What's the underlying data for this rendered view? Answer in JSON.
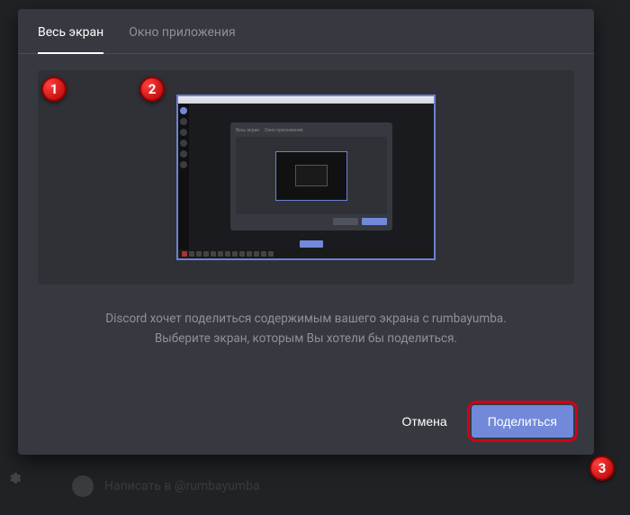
{
  "tabs": {
    "entire_screen": "Весь экран",
    "app_window": "Окно приложения"
  },
  "description": {
    "line1": "Discord хочет поделиться содержимым вашего экрана с rumbayumba.",
    "line2": "Выберите экран, которым Вы хотели бы поделиться."
  },
  "footer": {
    "cancel": "Отмена",
    "share": "Поделиться"
  },
  "callouts": {
    "one": "1",
    "two": "2",
    "three": "3"
  },
  "background": {
    "status_text": "Написать в @rumbayumba"
  },
  "inner_modal_tabs": {
    "a": "Весь экран",
    "b": "Окно приложения"
  }
}
